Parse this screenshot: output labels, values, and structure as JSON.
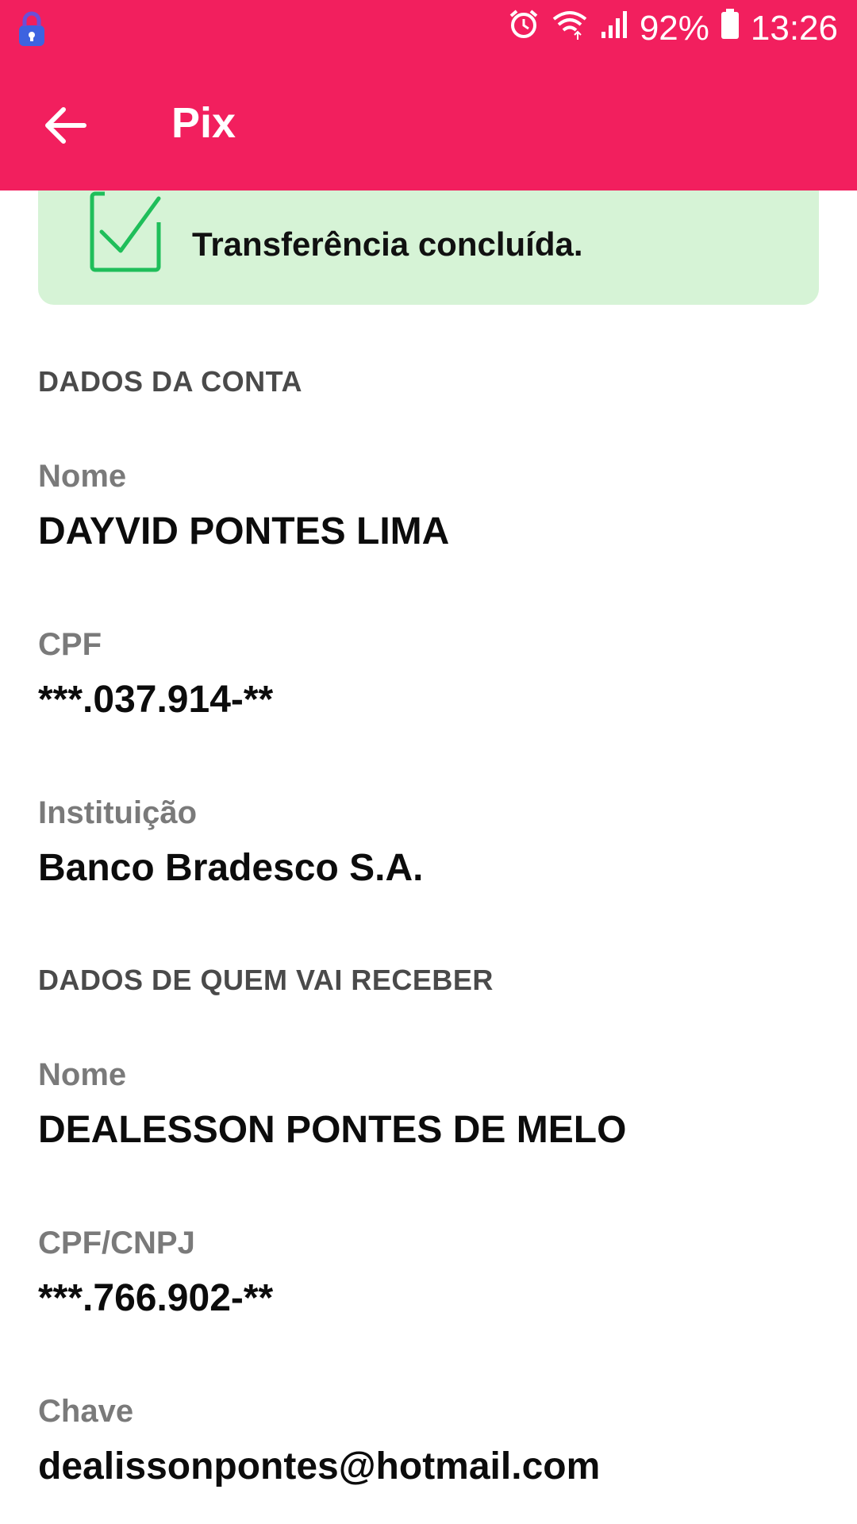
{
  "status_bar": {
    "battery": "92%",
    "time": "13:26",
    "icons": [
      "lock-icon",
      "alarm-icon",
      "wifi-icon",
      "signal-icon",
      "battery-icon"
    ]
  },
  "app_bar": {
    "title": "Pix",
    "back_icon": "arrow-left-icon"
  },
  "banner": {
    "message": "Transferência concluída.",
    "icon": "check-square-icon"
  },
  "account_section": {
    "title": "DADOS DA CONTA",
    "fields": [
      {
        "label": "Nome",
        "value": "DAYVID PONTES LIMA"
      },
      {
        "label": "CPF",
        "value": "***.037.914-**"
      },
      {
        "label": "Instituição",
        "value": "Banco Bradesco S.A."
      }
    ]
  },
  "receiver_section": {
    "title": "DADOS DE QUEM VAI RECEBER",
    "fields": [
      {
        "label": "Nome",
        "value": "DEALESSON PONTES DE MELO"
      },
      {
        "label": "CPF/CNPJ",
        "value": "***.766.902-**"
      },
      {
        "label": "Chave",
        "value": "dealissonpontes@hotmail.com"
      }
    ]
  },
  "colors": {
    "primary": "#f21f5e",
    "success_bg": "#d6f3d6",
    "success_icon": "#1fbe5a",
    "label_gray": "#7a7a7a"
  }
}
